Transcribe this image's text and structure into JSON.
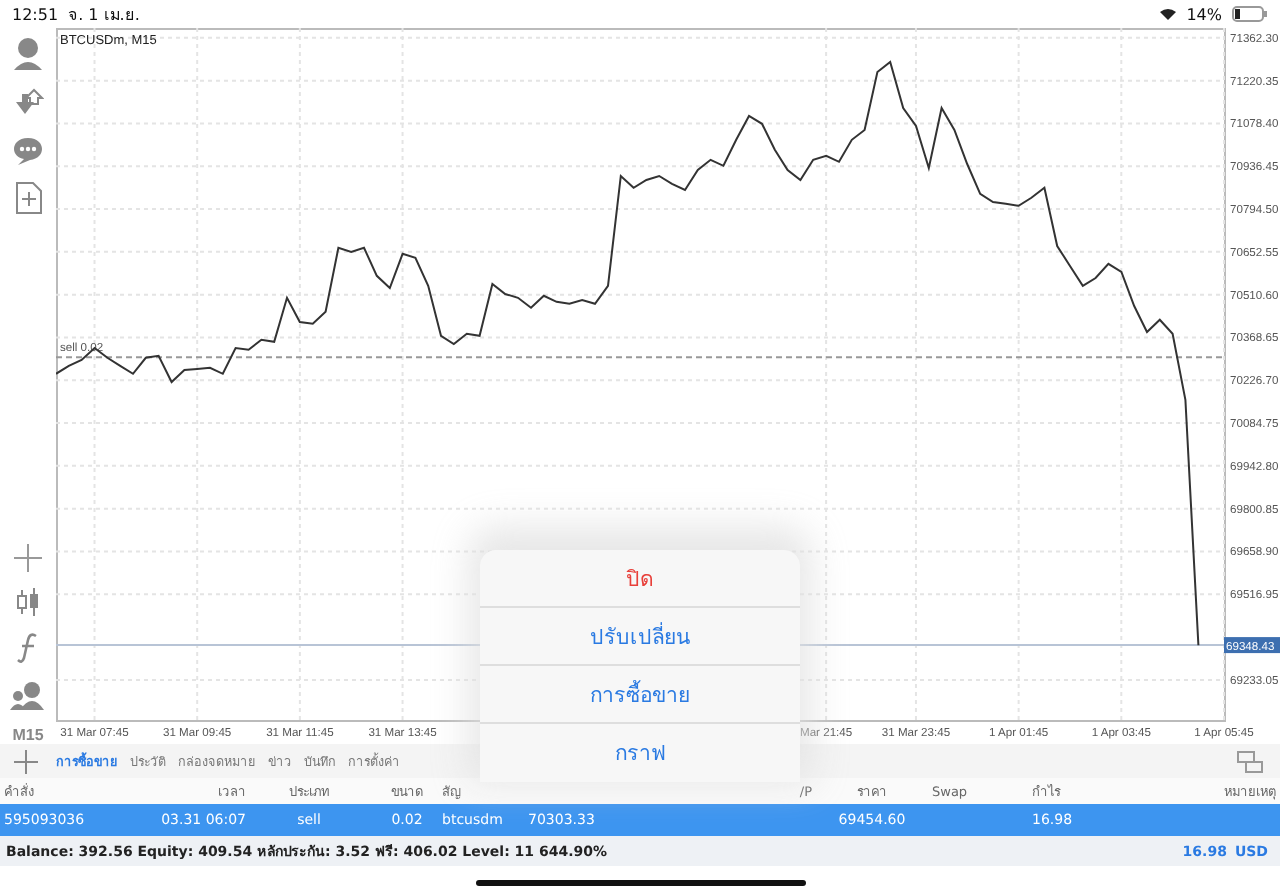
{
  "status_bar": {
    "time": "12:51",
    "date": "จ. 1 เม.ย.",
    "battery": "14%"
  },
  "toolbar_bottom_label": "M15",
  "chart": {
    "chart_data": {
      "type": "line",
      "title": "BTCUSDm, M15",
      "ylim": [
        69100,
        71395
      ],
      "grid": true,
      "ref_lines": [
        {
          "axis": "y",
          "value": 70303.33,
          "label": "sell 0.02"
        },
        {
          "axis": "y",
          "value": 69348.43,
          "label": "69348.43"
        }
      ],
      "categories": [
        null,
        null,
        null,
        "31 Mar 07:45",
        null,
        null,
        null,
        null,
        null,
        null,
        null,
        "31 Mar 09:45",
        null,
        null,
        null,
        null,
        null,
        null,
        null,
        "31 Mar 11:45",
        null,
        null,
        null,
        null,
        null,
        null,
        null,
        "31 Mar 13:45",
        null,
        null,
        null,
        null,
        null,
        null,
        null,
        null,
        null,
        null,
        null,
        null,
        null,
        null,
        null,
        null,
        null,
        null,
        null,
        null,
        null,
        null,
        null,
        null,
        null,
        null,
        null,
        null,
        null,
        null,
        null,
        null,
        "Mar 21:45",
        null,
        null,
        null,
        null,
        null,
        null,
        "31 Mar 23:45",
        null,
        null,
        null,
        null,
        null,
        null,
        null,
        "1 Apr 01:45",
        null,
        null,
        null,
        null,
        null,
        null,
        null,
        "1 Apr 03:45",
        null,
        null,
        null,
        null,
        null,
        null,
        null,
        "1 Apr 05:45"
      ],
      "series": [
        {
          "color": "#333333",
          "values": [
            70248,
            70275,
            70294,
            70334,
            70301,
            70275,
            70248,
            70301,
            70308,
            70221,
            70261,
            70264,
            70268,
            70248,
            70334,
            70328,
            70361,
            70354,
            70500,
            70420,
            70414,
            70454,
            70666,
            70652,
            70666,
            70573,
            70533,
            70646,
            70633,
            70540,
            70374,
            70347,
            70381,
            70374,
            70546,
            70513,
            70500,
            70467,
            70507,
            70487,
            70480,
            70493,
            70480,
            70540,
            70904,
            70865,
            70891,
            70904,
            70878,
            70858,
            70924,
            70958,
            70938,
            71024,
            71103,
            71077,
            70991,
            70924,
            70891,
            70958,
            70971,
            70951,
            71024,
            71057,
            71249,
            71282,
            71130,
            71070,
            70931,
            71130,
            71057,
            70944,
            70845,
            70818,
            70812,
            70805,
            70832,
            70865,
            70672,
            70606,
            70540,
            70566,
            70613,
            70586,
            70473,
            70387,
            70427,
            70381,
            70162,
            69348,
            null,
            null
          ]
        }
      ],
      "yticks": [
        {
          "value": 71362.3,
          "label": "71362.30"
        },
        {
          "value": 71220.35,
          "label": "71220.35"
        },
        {
          "value": 71078.4,
          "label": "71078.40"
        },
        {
          "value": 70936.45,
          "label": "70936.45"
        },
        {
          "value": 70794.5,
          "label": "70794.50"
        },
        {
          "value": 70652.55,
          "label": "70652.55"
        },
        {
          "value": 70510.6,
          "label": "70510.60"
        },
        {
          "value": 70368.65,
          "label": "70368.65"
        },
        {
          "value": 70226.7,
          "label": "70226.70"
        },
        {
          "value": 70084.75,
          "label": "70084.75"
        },
        {
          "value": 69942.8,
          "label": "69942.80"
        },
        {
          "value": 69800.85,
          "label": "69800.85"
        },
        {
          "value": 69658.9,
          "label": "69658.90"
        },
        {
          "value": 69516.95,
          "label": "69516.95"
        },
        {
          "value": 69233.05,
          "label": "69233.05"
        }
      ]
    }
  },
  "tabs": [
    {
      "label": "การซื้อขาย",
      "selected": true
    },
    {
      "label": "ประวัติ",
      "selected": false
    },
    {
      "label": "กล่องจดหมาย",
      "selected": false
    },
    {
      "label": "ข่าว",
      "selected": false
    },
    {
      "label": "บันทึก",
      "selected": false
    },
    {
      "label": "การตั้งค่า",
      "selected": false
    }
  ],
  "table": {
    "columns": [
      {
        "label": "คำสั่ง"
      },
      {
        "label": "เวลา"
      },
      {
        "label": "ประเภท"
      },
      {
        "label": "ขนาด"
      },
      {
        "label": "สัญ"
      },
      {},
      {},
      {
        "label": "/P"
      },
      {
        "label": "ราคา"
      },
      {
        "label": "Swap"
      },
      {
        "label": "กำไร"
      },
      {
        "label": "หมายเหตุ"
      }
    ],
    "rows": [
      {
        "selected": true,
        "cells": [
          "595093036",
          "03.31 06:07",
          "sell",
          "0.02",
          "btcusdm",
          "70303.33",
          null,
          null,
          "69454.60",
          null,
          "16.98",
          null
        ]
      }
    ]
  },
  "summary": {
    "text": "Balance: 392.56 Equity: 409.54 หลักประกัน: 3.52 ฟรี: 406.02 Level: 11 644.90%",
    "profit": "16.98",
    "currency": "USD"
  },
  "action_sheet": {
    "items": [
      {
        "label": "ปิด",
        "kind": "destructive"
      },
      {
        "label": "ปรับเปลี่ยน",
        "kind": "default"
      },
      {
        "label": "การซื้อขาย",
        "kind": "default"
      },
      {
        "label": "กราฟ",
        "kind": "default"
      }
    ]
  }
}
